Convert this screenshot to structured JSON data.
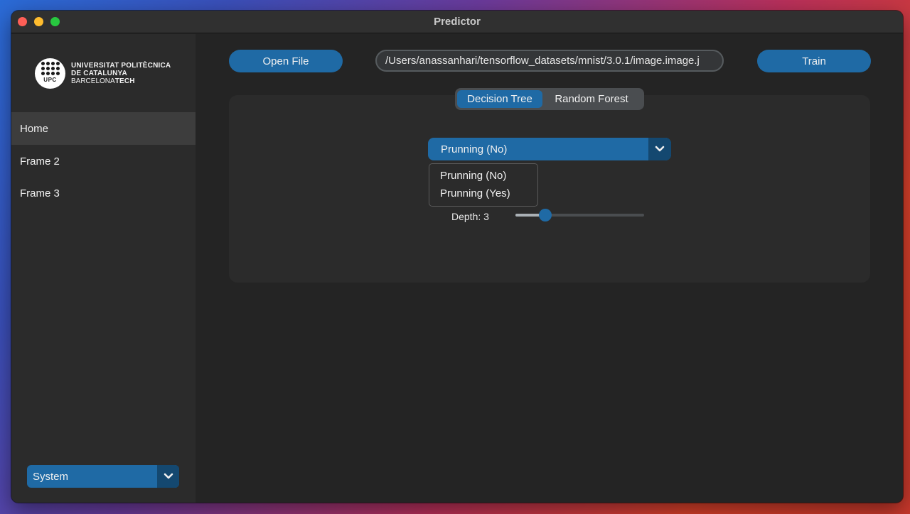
{
  "window": {
    "title": "Predictor"
  },
  "sidebar": {
    "logo": {
      "line1": "UNIVERSITAT POLITÈCNICA",
      "line2": "DE CATALUNYA",
      "line3a": "BARCELONA",
      "line3b": "TECH",
      "abbr": "UPC"
    },
    "items": [
      {
        "label": "Home",
        "active": true
      },
      {
        "label": "Frame 2",
        "active": false
      },
      {
        "label": "Frame 3",
        "active": false
      }
    ],
    "appearance_select": {
      "value": "System"
    }
  },
  "toolbar": {
    "open_file_label": "Open File",
    "file_path": "/Users/anassanhari/tensorflow_datasets/mnist/3.0.1/image.image.j",
    "train_label": "Train"
  },
  "tabs": [
    {
      "label": "Decision Tree",
      "selected": true
    },
    {
      "label": "Random Forest",
      "selected": false
    }
  ],
  "pruning": {
    "value": "Prunning (No)",
    "options": [
      "Prunning (No)",
      "Prunning (Yes)"
    ]
  },
  "depth": {
    "label": "Depth: 3",
    "value_fraction": 0.23
  },
  "colors": {
    "accent": "#1f6aa5",
    "accent_dark": "#144870",
    "background": "#242424",
    "sidebar": "#2b2b2b"
  }
}
